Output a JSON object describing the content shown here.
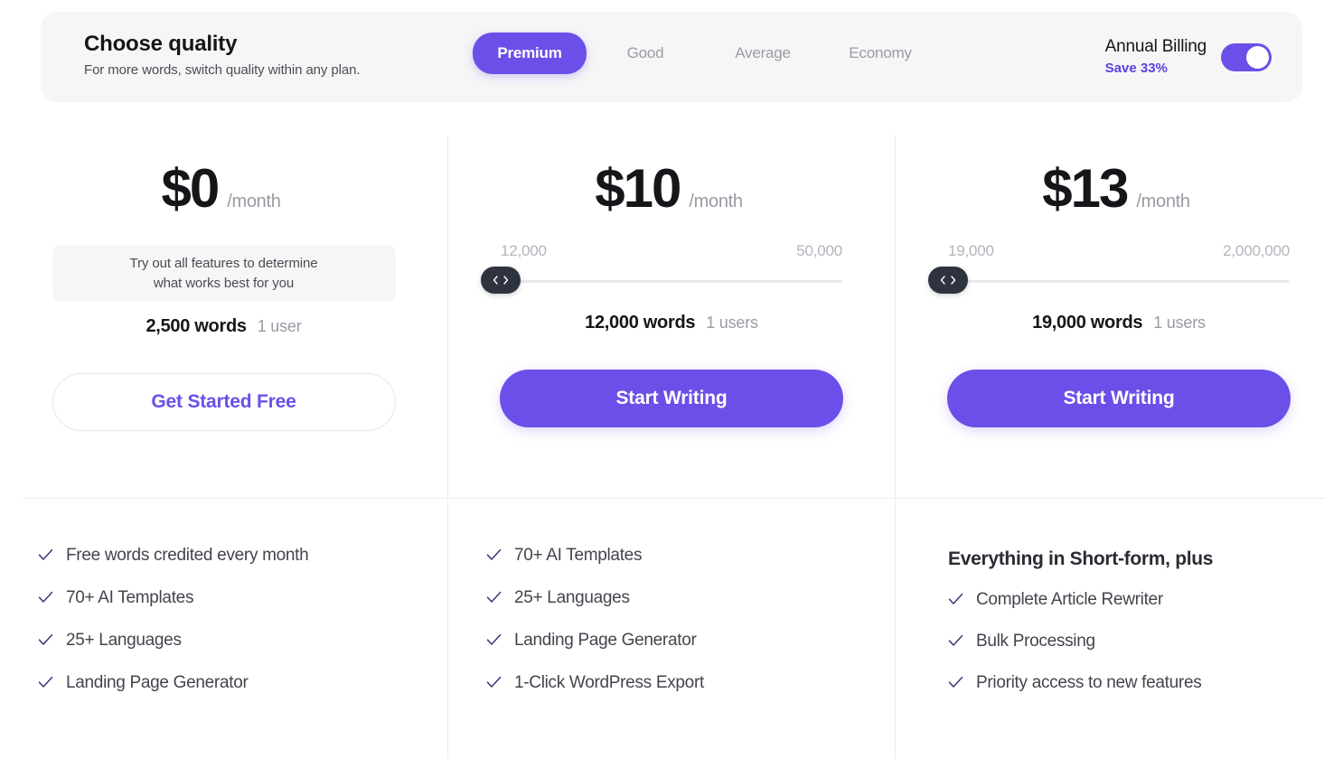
{
  "quality_bar": {
    "title": "Choose quality",
    "subtitle": "For more words, switch quality within any plan.",
    "tabs": [
      {
        "label": "Premium",
        "active": true
      },
      {
        "label": "Good",
        "active": false
      },
      {
        "label": "Average",
        "active": false
      },
      {
        "label": "Economy",
        "active": false
      }
    ],
    "billing": {
      "title": "Annual Billing",
      "save_label": "Save 33%",
      "toggle_on": true
    }
  },
  "accent_color": "#6c4fe8",
  "plans": [
    {
      "price_amount": "$0",
      "price_period": "/month",
      "info_box_line1": "Try out all features to determine",
      "info_box_line2": "what works best for you",
      "usage_words": "2,500 words",
      "usage_users": "1 user",
      "cta_label": "Get Started Free",
      "cta_style": "outline",
      "features_heading": "",
      "features": [
        "Free words credited every month",
        "70+ AI Templates",
        "25+ Languages",
        "Landing Page Generator"
      ]
    },
    {
      "price_amount": "$10",
      "price_period": "/month",
      "slider_min_label": "12,000",
      "slider_max_label": "50,000",
      "slider_value_pct": 0,
      "usage_words": "12,000 words",
      "usage_users": "1 users",
      "cta_label": "Start Writing",
      "cta_style": "primary",
      "features_heading": "",
      "features": [
        "70+ AI Templates",
        "25+ Languages",
        "Landing Page Generator",
        "1-Click WordPress Export"
      ]
    },
    {
      "price_amount": "$13",
      "price_period": "/month",
      "slider_min_label": "19,000",
      "slider_max_label": "2,000,000",
      "slider_value_pct": 0,
      "usage_words": "19,000 words",
      "usage_users": "1 users",
      "cta_label": "Start Writing",
      "cta_style": "primary",
      "features_heading": "Everything in Short-form, plus",
      "features": [
        "Complete Article Rewriter",
        "Bulk Processing",
        "Priority access to new features"
      ]
    }
  ]
}
